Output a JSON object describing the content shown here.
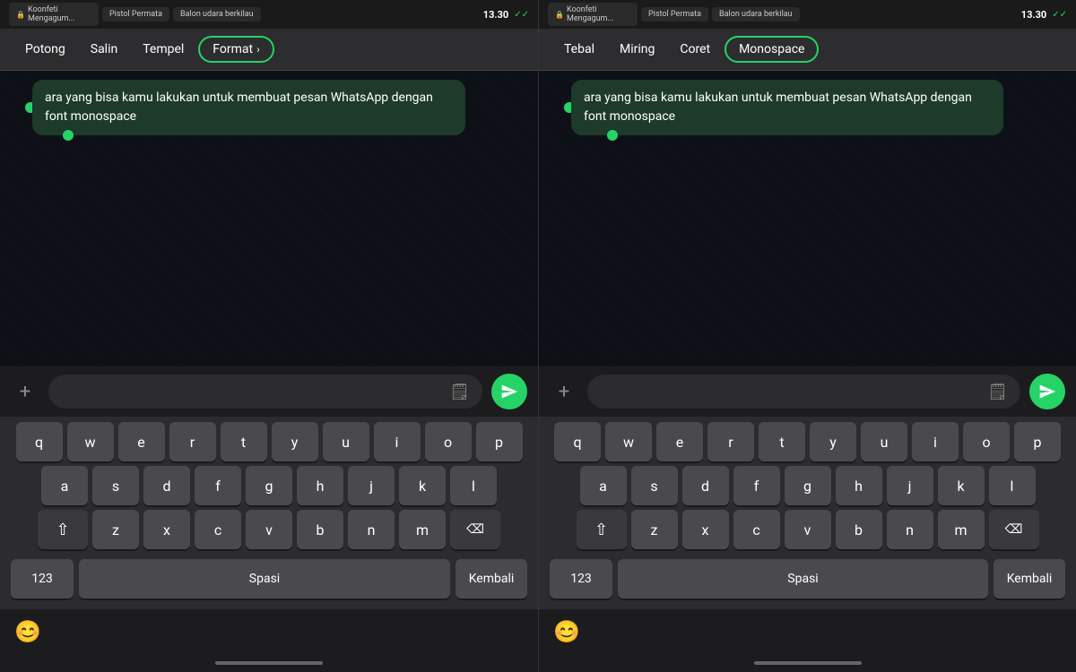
{
  "panels": [
    {
      "id": "panel-left",
      "statusBar": {
        "tabs": [
          {
            "icon": "🔒",
            "label": "Koonfeti Mengagum..."
          },
          {
            "icon": "",
            "label": "Pistol Permata"
          },
          {
            "icon": "",
            "label": "Balon udara berkilau"
          }
        ],
        "time": "13.30",
        "checkmarks": "✓✓"
      },
      "contextMenu": {
        "items": [
          {
            "label": "Potong",
            "highlighted": false
          },
          {
            "label": "Salin",
            "highlighted": false
          },
          {
            "label": "Tempel",
            "highlighted": false
          },
          {
            "label": "Format",
            "highlighted": true,
            "hasChevron": true
          }
        ]
      },
      "message": {
        "text": "ara yang bisa kamu lakukan untuk membuat pesan WhatsApp dengan font monospace"
      },
      "keyboard": {
        "rows": [
          [
            "q",
            "w",
            "e",
            "r",
            "t",
            "y",
            "u",
            "i",
            "o",
            "p"
          ],
          [
            "a",
            "s",
            "d",
            "f",
            "g",
            "h",
            "j",
            "k",
            "l"
          ],
          [
            "z",
            "x",
            "c",
            "v",
            "b",
            "n",
            "m"
          ]
        ],
        "bottomRow": {
          "numbers": "123",
          "space": "Spasi",
          "return": "Kembali"
        }
      },
      "emoji": "😊"
    },
    {
      "id": "panel-right",
      "statusBar": {
        "tabs": [
          {
            "icon": "🔒",
            "label": "Koonfeti Mengagum..."
          },
          {
            "icon": "",
            "label": "Pistol Permata"
          },
          {
            "icon": "",
            "label": "Balon udara berkilau"
          }
        ],
        "time": "13.30",
        "checkmarks": "✓✓"
      },
      "contextMenu": {
        "items": [
          {
            "label": "Tebal",
            "highlighted": false
          },
          {
            "label": "Miring",
            "highlighted": false
          },
          {
            "label": "Coret",
            "highlighted": false
          },
          {
            "label": "Monospace",
            "highlighted": true,
            "hasChevron": false
          }
        ]
      },
      "message": {
        "text": "ara yang bisa kamu lakukan untuk membuat pesan WhatsApp dengan font monospace"
      },
      "keyboard": {
        "rows": [
          [
            "q",
            "w",
            "e",
            "r",
            "t",
            "y",
            "u",
            "i",
            "o",
            "p"
          ],
          [
            "a",
            "s",
            "d",
            "f",
            "g",
            "h",
            "j",
            "k",
            "l"
          ],
          [
            "z",
            "x",
            "c",
            "v",
            "b",
            "n",
            "m"
          ]
        ],
        "bottomRow": {
          "numbers": "123",
          "space": "Spasi",
          "return": "Kembali"
        }
      },
      "emoji": "😊"
    }
  ]
}
